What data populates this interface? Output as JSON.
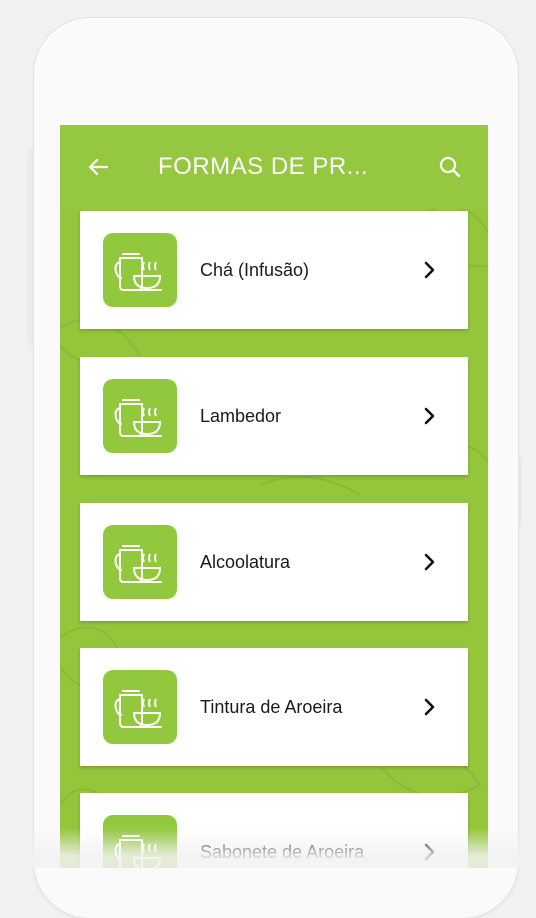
{
  "appbar": {
    "title": "FORMAS DE PR...",
    "back_icon": "arrow-left-icon",
    "search_icon": "search-icon"
  },
  "colors": {
    "primary": "#95c840",
    "card_bg": "#ffffff",
    "thumb_bg": "#92c83e"
  },
  "items": [
    {
      "label": "Chá (Infusão)",
      "icon": "teapot-cup-icon"
    },
    {
      "label": "Lambedor",
      "icon": "teapot-cup-icon"
    },
    {
      "label": "Alcoolatura",
      "icon": "teapot-cup-icon"
    },
    {
      "label": "Tintura de Aroeira",
      "icon": "teapot-cup-icon"
    },
    {
      "label": "Sabonete de Aroeira",
      "icon": "teapot-cup-icon"
    }
  ]
}
